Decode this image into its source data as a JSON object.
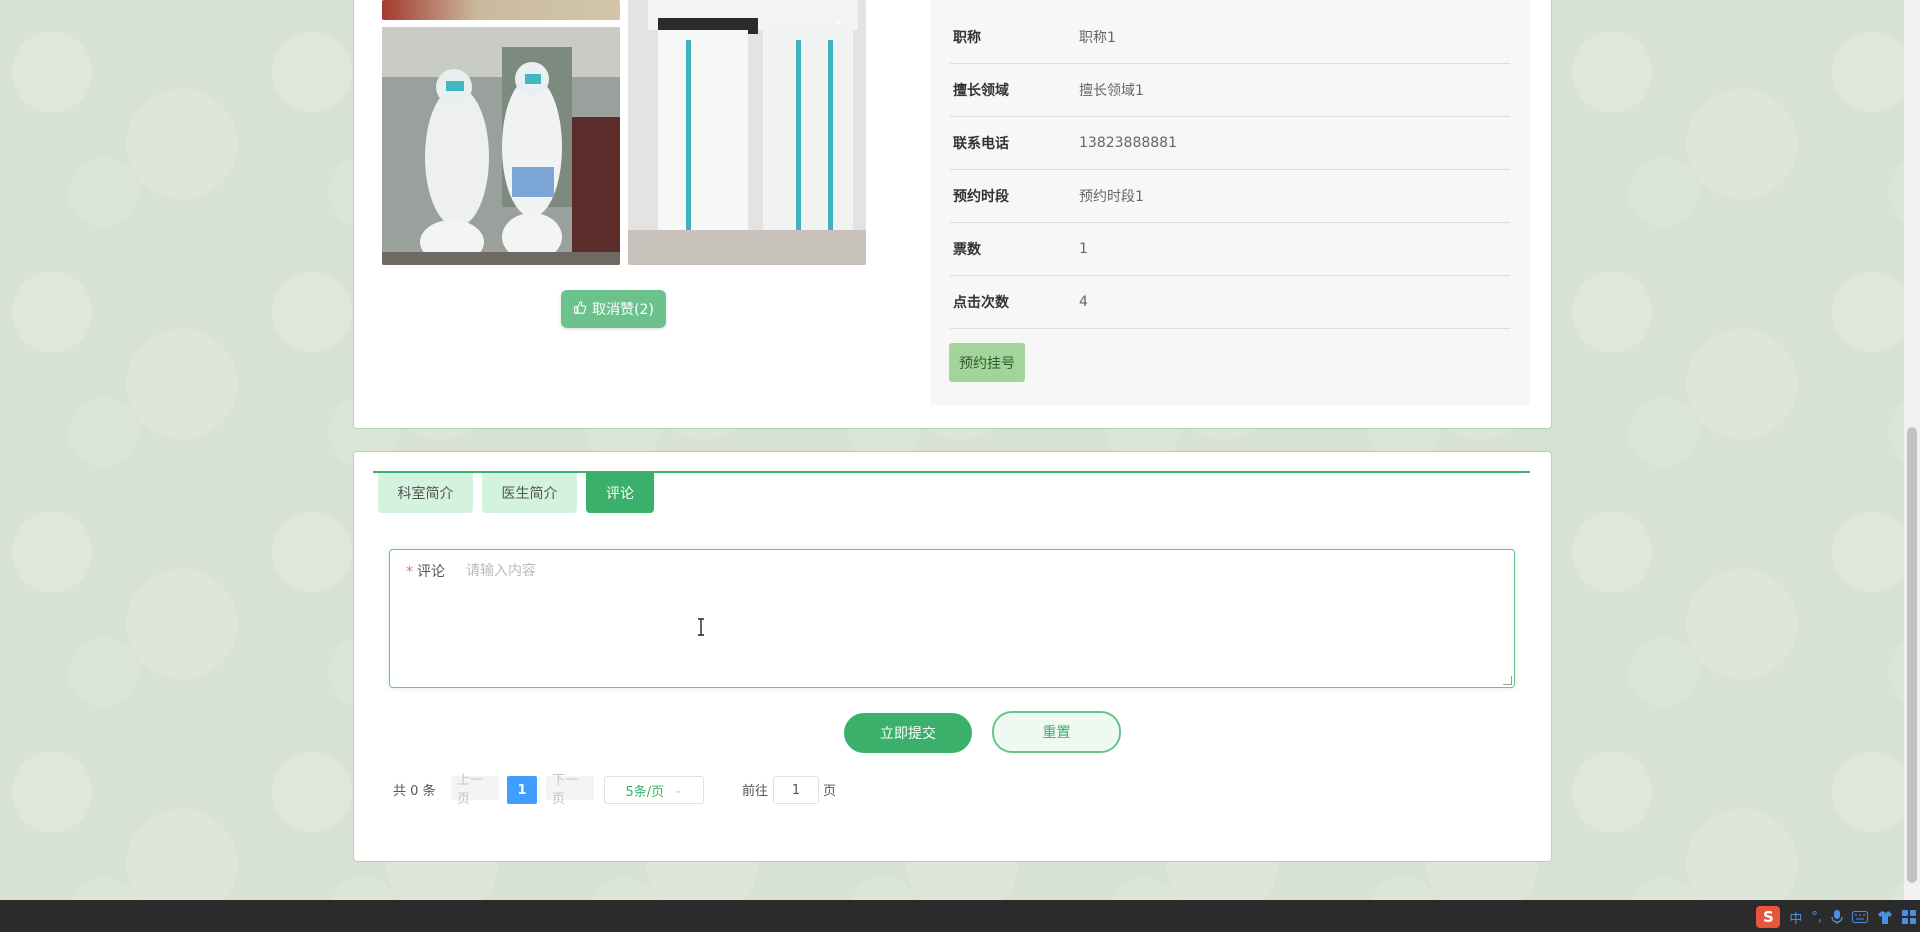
{
  "detail": {
    "like_button_label": "取消赞(2)",
    "rows": [
      {
        "label": "职称",
        "value": "职称1"
      },
      {
        "label": "擅长领域",
        "value": "擅长领域1"
      },
      {
        "label": "联系电话",
        "value": "13823888881"
      },
      {
        "label": "预约时段",
        "value": "预约时段1"
      },
      {
        "label": "票数",
        "value": "1"
      },
      {
        "label": "点击次数",
        "value": "4"
      }
    ],
    "book_button_label": "预约挂号"
  },
  "tabs": [
    {
      "label": "科室简介"
    },
    {
      "label": "医生简介"
    },
    {
      "label": "评论"
    }
  ],
  "comment_form": {
    "required_mark": "*",
    "label": "评论",
    "placeholder": "请输入内容",
    "submit_label": "立即提交",
    "reset_label": "重置"
  },
  "pagination": {
    "total_text": "共 0 条",
    "prev_label": "上一页",
    "current_page": "1",
    "next_label": "下一页",
    "page_size_label": "5条/页",
    "goto_label": "前往",
    "goto_value": "1",
    "page_suffix": "页"
  },
  "ime_tray": {
    "logo": "S",
    "lang": "中",
    "punct": "°,",
    "icons": [
      "mic-icon",
      "keyboard-icon",
      "shirt-icon",
      "grid-icon"
    ]
  },
  "colors": {
    "accent": "#3bb06a",
    "accent_light": "#6cc28c",
    "tab_inactive": "#d4f3df",
    "book_button": "#a3d49a",
    "pager_active": "#409eff"
  }
}
